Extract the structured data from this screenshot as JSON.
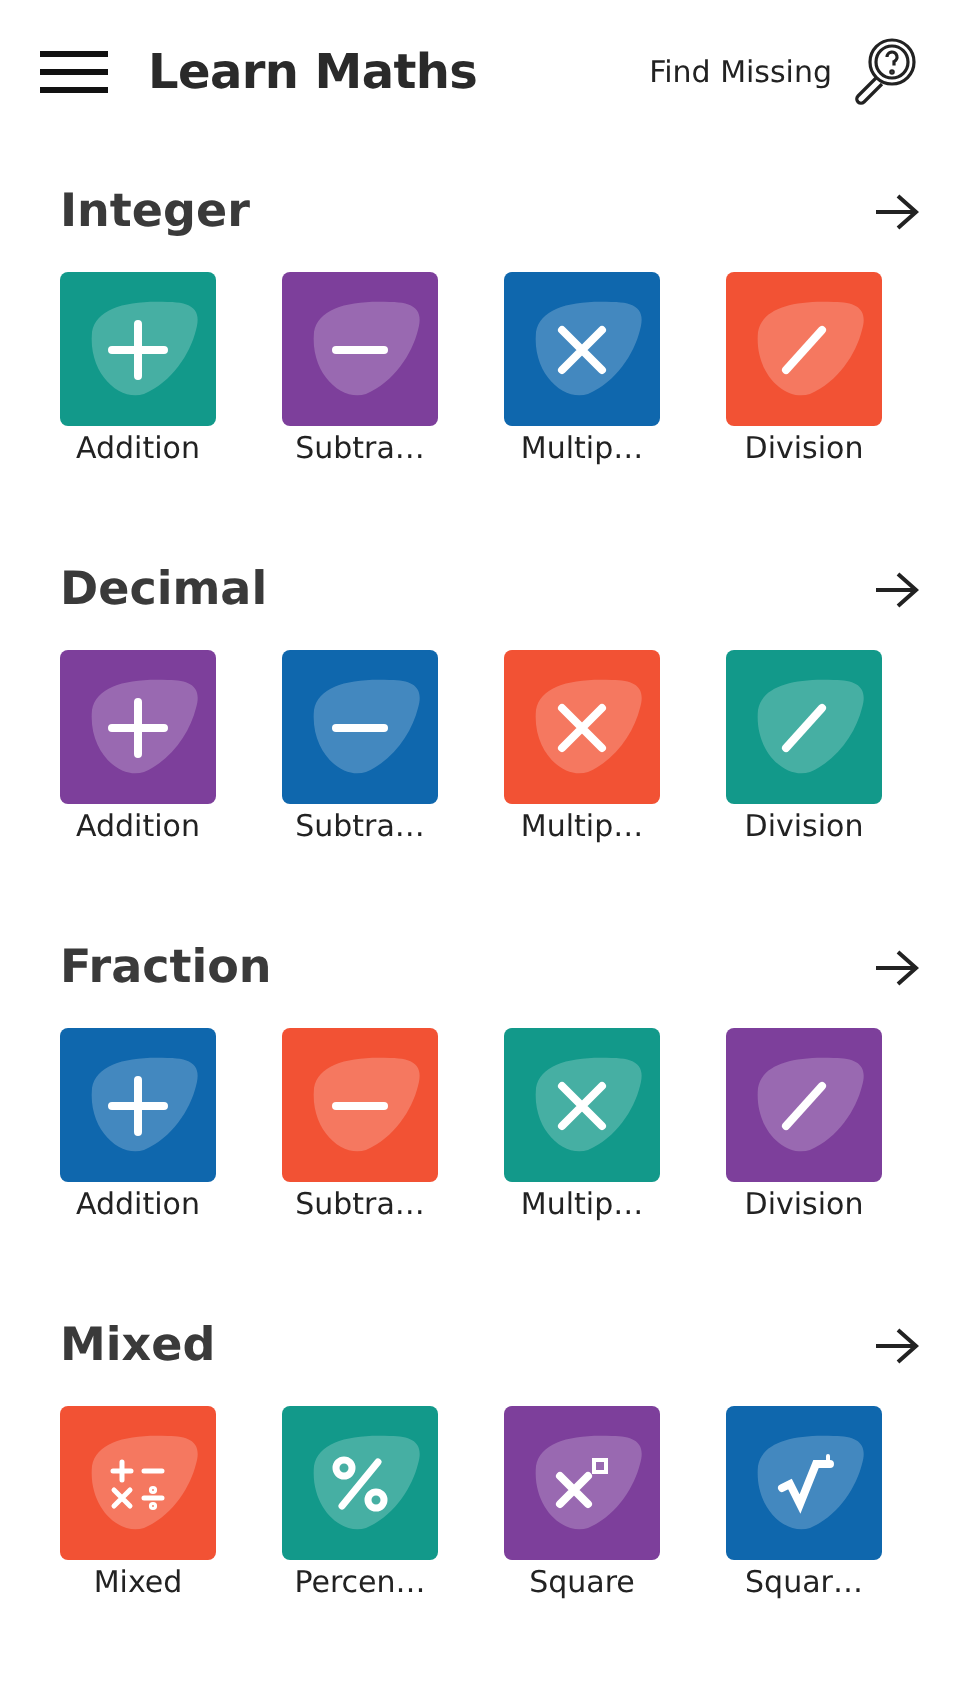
{
  "header": {
    "title": "Learn Maths",
    "action": "Find Missing"
  },
  "sections": [
    {
      "title": "Integer",
      "items": [
        {
          "label": "Addition",
          "kind": "plus",
          "color": "#12998a"
        },
        {
          "label": "Subtra…",
          "kind": "minus",
          "color": "#7d3f9b"
        },
        {
          "label": "Multip…",
          "kind": "times",
          "color": "#0f67ad"
        },
        {
          "label": "Division",
          "kind": "divide",
          "color": "#f25234"
        }
      ]
    },
    {
      "title": "Decimal",
      "items": [
        {
          "label": "Addition",
          "kind": "plus",
          "color": "#7d3f9b"
        },
        {
          "label": "Subtra…",
          "kind": "minus",
          "color": "#0f67ad"
        },
        {
          "label": "Multip…",
          "kind": "times",
          "color": "#f25234"
        },
        {
          "label": "Division",
          "kind": "divide",
          "color": "#12998a"
        }
      ]
    },
    {
      "title": "Fraction",
      "items": [
        {
          "label": "Addition",
          "kind": "plus",
          "color": "#0f67ad"
        },
        {
          "label": "Subtra…",
          "kind": "minus",
          "color": "#f25234"
        },
        {
          "label": "Multip…",
          "kind": "times",
          "color": "#12998a"
        },
        {
          "label": "Division",
          "kind": "divide",
          "color": "#7d3f9b"
        }
      ]
    },
    {
      "title": "Mixed",
      "items": [
        {
          "label": "Mixed",
          "kind": "mixed",
          "color": "#f25234"
        },
        {
          "label": "Percen…",
          "kind": "percent",
          "color": "#12998a"
        },
        {
          "label": "Square",
          "kind": "square",
          "color": "#7d3f9b"
        },
        {
          "label": "Squar…",
          "kind": "root",
          "color": "#0f67ad"
        }
      ]
    }
  ]
}
